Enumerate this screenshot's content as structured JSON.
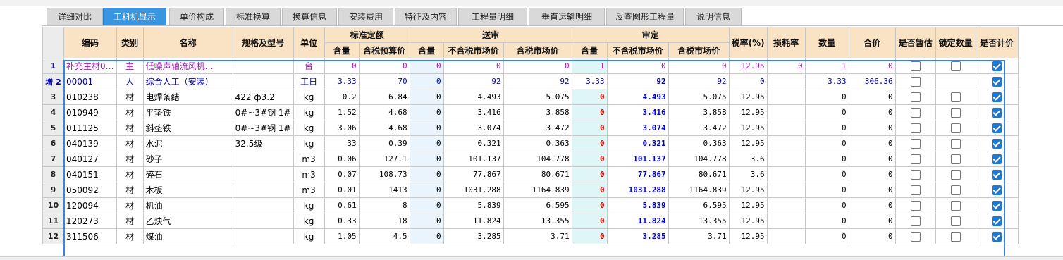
{
  "tabs": [
    {
      "label": "详细对比"
    },
    {
      "label": "工料机显示",
      "active": true
    },
    {
      "label": "单价构成"
    },
    {
      "label": "标准换算"
    },
    {
      "label": "换算信息"
    },
    {
      "label": "安装费用"
    },
    {
      "label": "特征及内容"
    },
    {
      "label": "工程量明细"
    },
    {
      "label": "垂直运输明细"
    },
    {
      "label": "反查图形工程量"
    },
    {
      "label": "说明信息"
    }
  ],
  "headers": {
    "code": "编码",
    "type": "类别",
    "name": "名称",
    "spec": "规格及型号",
    "unit": "单位",
    "standard": "标准定额",
    "review": "送审",
    "approved": "审定",
    "qty": "含量",
    "tax_budget_price": "含税预算价",
    "notax_market_price": "不含税市场价",
    "tax_market_price": "含税市场价",
    "tax_rate": "税率(%)",
    "loss_rate": "损耗率",
    "quantity": "数量",
    "total": "合价",
    "is_temp": "是否暂估",
    "lock_qty": "锁定数量",
    "is_price": "是否计价"
  },
  "rows": [
    {
      "rownum": "1",
      "code": "补充主材0…",
      "type": "主",
      "name": "低噪声轴流风机…",
      "spec": "",
      "unit": "台",
      "std_qty": "0",
      "std_price": "0",
      "rev_qty": "0",
      "rev_notax": "0",
      "rev_tax": "0",
      "app_qty": "1",
      "app_notax": "0",
      "app_tax": "0",
      "tax_rate": "12.95",
      "loss": "0",
      "quantity": "1",
      "total": "0",
      "temp": false,
      "lock": false,
      "price": true
    },
    {
      "rownum": "增 2",
      "code": "00001",
      "type": "人",
      "name": "综合人工（安装）",
      "spec": "",
      "unit": "工日",
      "std_qty": "3.33",
      "std_price": "70",
      "rev_qty": "0",
      "rev_notax": "92",
      "rev_tax": "92",
      "app_qty": "3.33",
      "app_notax": "92",
      "app_tax": "92",
      "tax_rate": "0",
      "loss": "",
      "quantity": "3.33",
      "total": "306.36",
      "temp": false,
      "lock": false,
      "price": true
    },
    {
      "rownum": "3",
      "code": "010238",
      "type": "材",
      "name": "电焊条结",
      "spec": "422 ф3.2",
      "unit": "kg",
      "std_qty": "0.2",
      "std_price": "6.84",
      "rev_qty": "0",
      "rev_notax": "4.493",
      "rev_tax": "5.075",
      "app_qty": "0",
      "app_notax": "4.493",
      "app_tax": "5.075",
      "tax_rate": "12.95",
      "loss": "",
      "quantity": "0",
      "total": "0",
      "temp": false,
      "lock": false,
      "price": true
    },
    {
      "rownum": "4",
      "code": "010949",
      "type": "材",
      "name": "平垫铁",
      "spec": "0#~3#钢 1#",
      "unit": "kg",
      "std_qty": "1.52",
      "std_price": "4.68",
      "rev_qty": "0",
      "rev_notax": "3.416",
      "rev_tax": "3.858",
      "app_qty": "0",
      "app_notax": "3.416",
      "app_tax": "3.858",
      "tax_rate": "12.95",
      "loss": "",
      "quantity": "0",
      "total": "0",
      "temp": false,
      "lock": false,
      "price": true
    },
    {
      "rownum": "5",
      "code": "011125",
      "type": "材",
      "name": "斜垫铁",
      "spec": "0#~3#钢 1#",
      "unit": "kg",
      "std_qty": "3.06",
      "std_price": "4.68",
      "rev_qty": "0",
      "rev_notax": "3.074",
      "rev_tax": "3.472",
      "app_qty": "0",
      "app_notax": "3.074",
      "app_tax": "3.472",
      "tax_rate": "12.95",
      "loss": "",
      "quantity": "0",
      "total": "0",
      "temp": false,
      "lock": false,
      "price": true
    },
    {
      "rownum": "6",
      "code": "040139",
      "type": "材",
      "name": "水泥",
      "spec": "32.5级",
      "unit": "kg",
      "std_qty": "33",
      "std_price": "0.39",
      "rev_qty": "0",
      "rev_notax": "0.321",
      "rev_tax": "0.363",
      "app_qty": "0",
      "app_notax": "0.321",
      "app_tax": "0.363",
      "tax_rate": "12.95",
      "loss": "",
      "quantity": "0",
      "total": "0",
      "temp": false,
      "lock": false,
      "price": true
    },
    {
      "rownum": "7",
      "code": "040127",
      "type": "材",
      "name": "砂子",
      "spec": "",
      "unit": "m3",
      "std_qty": "0.06",
      "std_price": "127.1",
      "rev_qty": "0",
      "rev_notax": "101.137",
      "rev_tax": "104.778",
      "app_qty": "0",
      "app_notax": "101.137",
      "app_tax": "104.778",
      "tax_rate": "3.6",
      "loss": "",
      "quantity": "0",
      "total": "0",
      "temp": false,
      "lock": false,
      "price": true
    },
    {
      "rownum": "8",
      "code": "040151",
      "type": "材",
      "name": "碎石",
      "spec": "",
      "unit": "m3",
      "std_qty": "0.07",
      "std_price": "108.73",
      "rev_qty": "0",
      "rev_notax": "77.867",
      "rev_tax": "80.671",
      "app_qty": "0",
      "app_notax": "77.867",
      "app_tax": "80.671",
      "tax_rate": "3.6",
      "loss": "",
      "quantity": "0",
      "total": "0",
      "temp": false,
      "lock": false,
      "price": true
    },
    {
      "rownum": "9",
      "code": "050092",
      "type": "材",
      "name": "木板",
      "spec": "",
      "unit": "m3",
      "std_qty": "0.01",
      "std_price": "1413",
      "rev_qty": "0",
      "rev_notax": "1031.288",
      "rev_tax": "1164.839",
      "app_qty": "0",
      "app_notax": "1031.288",
      "app_tax": "1164.839",
      "tax_rate": "12.95",
      "loss": "",
      "quantity": "0",
      "total": "0",
      "temp": false,
      "lock": false,
      "price": true
    },
    {
      "rownum": "10",
      "code": "120094",
      "type": "材",
      "name": "机油",
      "spec": "",
      "unit": "kg",
      "std_qty": "0.61",
      "std_price": "8",
      "rev_qty": "0",
      "rev_notax": "5.839",
      "rev_tax": "6.595",
      "app_qty": "0",
      "app_notax": "5.839",
      "app_tax": "6.595",
      "tax_rate": "12.95",
      "loss": "",
      "quantity": "0",
      "total": "0",
      "temp": false,
      "lock": false,
      "price": true
    },
    {
      "rownum": "11",
      "code": "120273",
      "type": "材",
      "name": "乙炔气",
      "spec": "",
      "unit": "kg",
      "std_qty": "0.33",
      "std_price": "18",
      "rev_qty": "0",
      "rev_notax": "11.824",
      "rev_tax": "13.355",
      "app_qty": "0",
      "app_notax": "11.824",
      "app_tax": "13.355",
      "tax_rate": "12.95",
      "loss": "",
      "quantity": "0",
      "total": "0",
      "temp": false,
      "lock": false,
      "price": true
    },
    {
      "rownum": "12",
      "code": "311506",
      "type": "材",
      "name": "煤油",
      "spec": "",
      "unit": "kg",
      "std_qty": "1.05",
      "std_price": "4.5",
      "rev_qty": "0",
      "rev_notax": "3.285",
      "rev_tax": "3.71",
      "app_qty": "0",
      "app_notax": "3.285",
      "app_tax": "3.71",
      "tax_rate": "12.95",
      "loss": "",
      "quantity": "0",
      "total": "0",
      "temp": false,
      "lock": false,
      "price": true
    }
  ],
  "colors": {
    "active_tab": "#3a95e1",
    "header_bg": "#fae3c4",
    "approved_red": "#d00000",
    "approved_blue": "#0000cc",
    "main_material": "#a01ab0",
    "labor": "#0000a0",
    "checkbox": "#1e78d2"
  }
}
